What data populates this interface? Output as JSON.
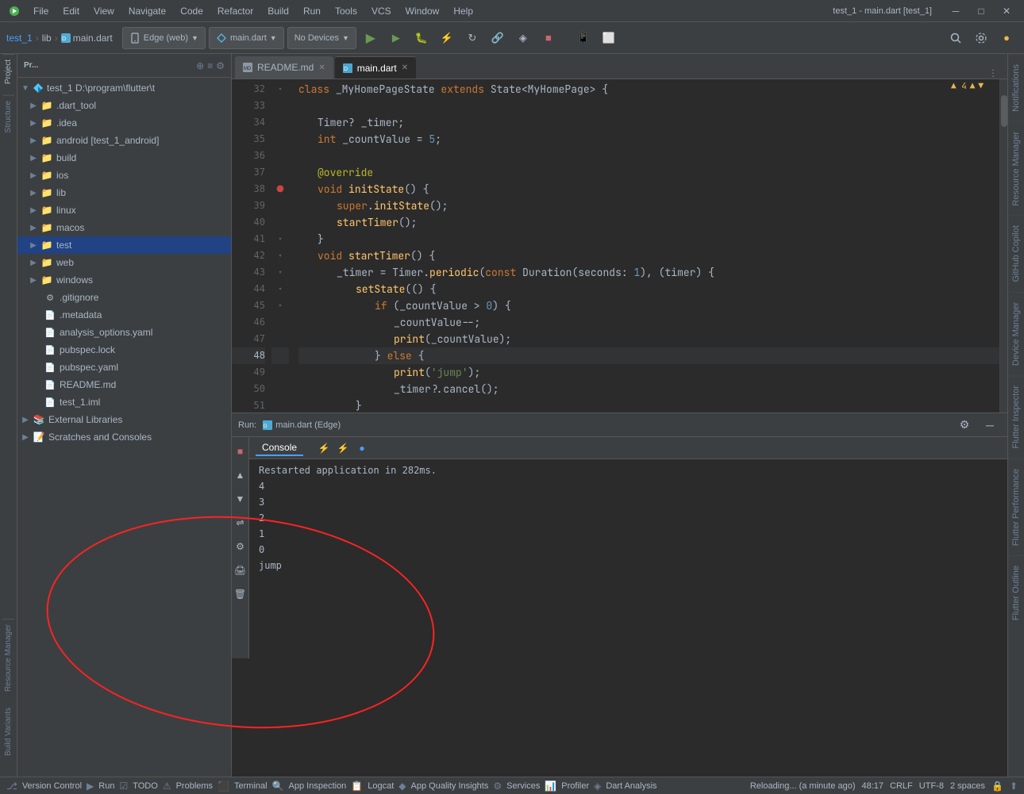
{
  "app": {
    "title": "test_1 - main.dart [test_1]"
  },
  "menu": {
    "items": [
      "File",
      "Edit",
      "View",
      "Navigate",
      "Code",
      "Refactor",
      "Build",
      "Run",
      "Tools",
      "VCS",
      "Window",
      "Help"
    ]
  },
  "toolbar": {
    "breadcrumb": [
      "test_1",
      "lib",
      "main.dart"
    ],
    "run_config_edge": "Edge (web)",
    "run_config_dart": "main.dart",
    "no_devices": "No Devices"
  },
  "tabs": {
    "items": [
      {
        "label": "README.md",
        "active": false,
        "icon": "md"
      },
      {
        "label": "main.dart",
        "active": true,
        "icon": "dart"
      }
    ]
  },
  "editor": {
    "warning_count": "▲ 4",
    "lines": [
      {
        "num": "32",
        "content": "class _MyHomePageState extends State<MyHomePage> {",
        "type": "class_def"
      },
      {
        "num": "33",
        "content": "",
        "type": "blank"
      },
      {
        "num": "34",
        "content": "  Timer? _timer;",
        "type": "code"
      },
      {
        "num": "35",
        "content": "  int _countValue = 5;",
        "type": "code"
      },
      {
        "num": "36",
        "content": "",
        "type": "blank"
      },
      {
        "num": "37",
        "content": "  @override",
        "type": "annotation"
      },
      {
        "num": "38",
        "content": "  void initState() {",
        "type": "code"
      },
      {
        "num": "39",
        "content": "    super.initState();",
        "type": "code"
      },
      {
        "num": "40",
        "content": "    startTimer();",
        "type": "code"
      },
      {
        "num": "41",
        "content": "  }",
        "type": "code"
      },
      {
        "num": "42",
        "content": "  void startTimer() {",
        "type": "code"
      },
      {
        "num": "43",
        "content": "    _timer = Timer.periodic(const Duration(seconds: 1), (timer) {",
        "type": "code"
      },
      {
        "num": "44",
        "content": "      setState(() {",
        "type": "code"
      },
      {
        "num": "45",
        "content": "        if (_countValue > 0) {",
        "type": "code"
      },
      {
        "num": "46",
        "content": "          _countValue--;",
        "type": "code"
      },
      {
        "num": "47",
        "content": "          print(_countValue);",
        "type": "code"
      },
      {
        "num": "48",
        "content": "        } else {",
        "type": "code",
        "highlighted": true
      },
      {
        "num": "49",
        "content": "          print('jump');",
        "type": "code"
      },
      {
        "num": "50",
        "content": "          _timer?.cancel();",
        "type": "code"
      },
      {
        "num": "51",
        "content": "      }",
        "type": "code"
      }
    ]
  },
  "project_tree": {
    "root_name": "test_1",
    "root_path": "D:\\program\\flutter\\t",
    "items": [
      {
        "name": ".dart_tool",
        "type": "folder",
        "indent": 1,
        "expanded": false
      },
      {
        "name": ".idea",
        "type": "folder",
        "indent": 1,
        "expanded": false
      },
      {
        "name": "android [test_1_android]",
        "type": "folder",
        "indent": 1,
        "expanded": false
      },
      {
        "name": "build",
        "type": "folder",
        "indent": 1,
        "expanded": false
      },
      {
        "name": "ios",
        "type": "folder",
        "indent": 1,
        "expanded": false
      },
      {
        "name": "lib",
        "type": "folder",
        "indent": 1,
        "expanded": false
      },
      {
        "name": "linux",
        "type": "folder",
        "indent": 1,
        "expanded": false
      },
      {
        "name": "macos",
        "type": "folder",
        "indent": 1,
        "expanded": false
      },
      {
        "name": "test",
        "type": "folder",
        "indent": 1,
        "expanded": true,
        "selected": true
      },
      {
        "name": "web",
        "type": "folder",
        "indent": 1,
        "expanded": false
      },
      {
        "name": "windows",
        "type": "folder",
        "indent": 1,
        "expanded": false
      },
      {
        "name": ".gitignore",
        "type": "file",
        "indent": 1,
        "fileType": "git"
      },
      {
        "name": ".metadata",
        "type": "file",
        "indent": 1,
        "fileType": "meta"
      },
      {
        "name": "analysis_options.yaml",
        "type": "file",
        "indent": 1,
        "fileType": "yaml"
      },
      {
        "name": "pubspec.lock",
        "type": "file",
        "indent": 1,
        "fileType": "yaml"
      },
      {
        "name": "pubspec.yaml",
        "type": "file",
        "indent": 1,
        "fileType": "yaml"
      },
      {
        "name": "README.md",
        "type": "file",
        "indent": 1,
        "fileType": "md"
      },
      {
        "name": "test_1.iml",
        "type": "file",
        "indent": 1,
        "fileType": "iml"
      }
    ],
    "externals": [
      "External Libraries",
      "Scratches and Consoles"
    ]
  },
  "run_panel": {
    "run_label": "Run:",
    "config_label": "main.dart (Edge)",
    "icon_label": "⚡",
    "console_tab": "Console",
    "output_lines": [
      {
        "text": "Restarted application in 282ms."
      },
      {
        "text": "4"
      },
      {
        "text": "3"
      },
      {
        "text": "2"
      },
      {
        "text": "1"
      },
      {
        "text": "0"
      },
      {
        "text": "jump"
      }
    ]
  },
  "status_bar": {
    "version_control": "Version Control",
    "run": "Run",
    "todo": "TODO",
    "problems": "Problems",
    "terminal": "Terminal",
    "app_inspection": "App Inspection",
    "logcat": "Logcat",
    "app_quality": "App Quality Insights",
    "services": "Services",
    "profiler": "Profiler",
    "dart_analysis": "Dart Analysis",
    "status_text": "Reloading... (a minute ago)",
    "position": "48:17",
    "line_ending": "CRLF",
    "encoding": "UTF-8",
    "indent": "2 spaces"
  },
  "right_panels": {
    "notifications": "Notifications",
    "resource_manager": "Resource Manager",
    "github_copilot": "GitHub Copilot",
    "device_manager": "Device Manager",
    "flutter_inspector": "Flutter Inspector",
    "flutter_performance": "Flutter Performance",
    "flutter_outline": "Flutter Outline"
  }
}
